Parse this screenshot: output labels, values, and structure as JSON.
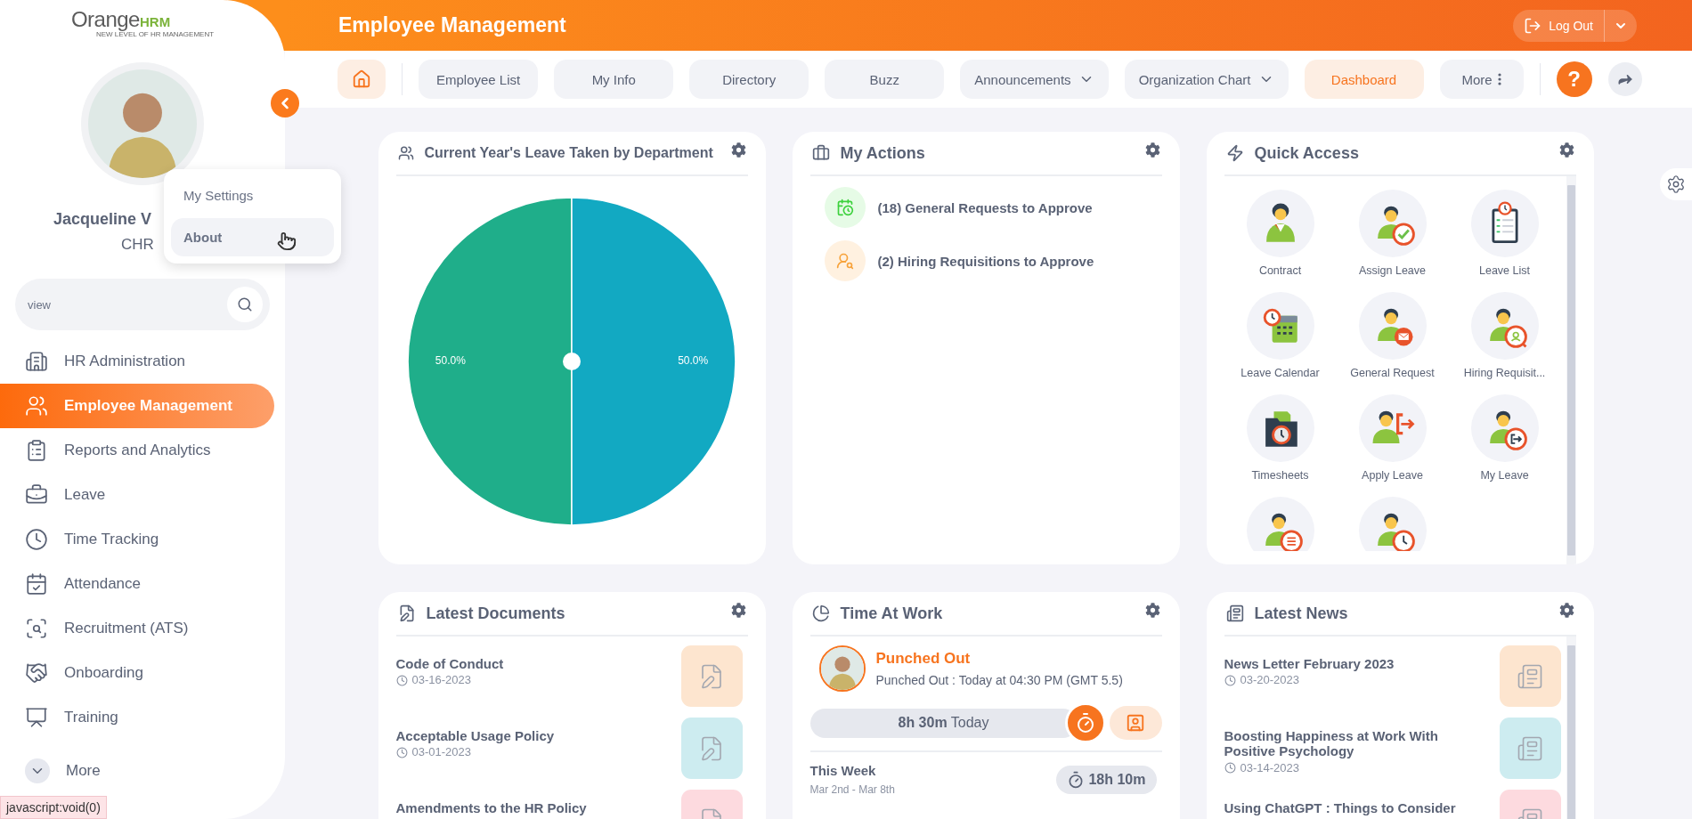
{
  "sidebar": {
    "logo": {
      "word": "Orange",
      "suffix": "HRM",
      "tagline": "NEW LEVEL OF HR MANAGEMENT"
    },
    "profile": {
      "name": "Jacqueline V",
      "role": "CHR"
    },
    "profile_menu": [
      {
        "label": "My Settings",
        "selected": false
      },
      {
        "label": "About",
        "selected": true
      }
    ],
    "search": {
      "placeholder": "view"
    },
    "items": [
      {
        "label": "HR Administration",
        "kind": "building",
        "selected": false
      },
      {
        "label": "Employee Management",
        "kind": "people",
        "selected": true
      },
      {
        "label": "Reports and Analytics",
        "kind": "report",
        "selected": false
      },
      {
        "label": "Leave",
        "kind": "leave",
        "selected": false
      },
      {
        "label": "Time Tracking",
        "kind": "time",
        "selected": false
      },
      {
        "label": "Attendance",
        "kind": "attendance",
        "selected": false
      },
      {
        "label": "Recruitment (ATS)",
        "kind": "recruit",
        "selected": false
      },
      {
        "label": "Onboarding",
        "kind": "onboarding",
        "selected": false
      },
      {
        "label": "Training",
        "kind": "training",
        "selected": false
      },
      {
        "label": "More",
        "kind": "more",
        "selected": false
      }
    ]
  },
  "header": {
    "title": "Employee Management",
    "logout_label": "Log Out"
  },
  "tabs": [
    {
      "kind": "home",
      "selected": false
    },
    {
      "kind": "tab",
      "label": "Employee List",
      "selected": false
    },
    {
      "kind": "tab",
      "label": "My Info",
      "selected": false
    },
    {
      "kind": "tab",
      "label": "Directory",
      "selected": false
    },
    {
      "kind": "tab",
      "label": "Buzz",
      "selected": false
    },
    {
      "kind": "dropdown",
      "label": "Announcements",
      "selected": false
    },
    {
      "kind": "dropdown",
      "label": "Organization Chart",
      "selected": false
    },
    {
      "kind": "tab",
      "label": "Dashboard",
      "selected": true
    },
    {
      "kind": "more",
      "label": "More",
      "selected": false
    }
  ],
  "help_label": "?",
  "leave_card": {
    "title": "Current Year's Leave Taken by Department",
    "chart_data": {
      "type": "pie",
      "values": [
        50,
        50
      ],
      "value_labels": [
        "50.0%",
        "50.0%"
      ],
      "colors": [
        "#1fae8a",
        "#12a9c2"
      ]
    }
  },
  "actions_card": {
    "title": "My Actions",
    "items": [
      {
        "label": "(18) General Requests to Approve",
        "color": "#e6fbe6"
      },
      {
        "label": "(2) Hiring Requisitions to Approve",
        "color": "#fff1e0"
      }
    ]
  },
  "quick_access": {
    "title": "Quick Access",
    "items": [
      {
        "label": "Contract",
        "kind": "woman"
      },
      {
        "label": "Assign Leave",
        "kind": "check"
      },
      {
        "label": "Leave List",
        "kind": "clipboard"
      },
      {
        "label": "Leave Calendar",
        "kind": "calendar"
      },
      {
        "label": "General Request",
        "kind": "mail"
      },
      {
        "label": "Hiring Requisit...",
        "kind": "search"
      },
      {
        "label": "Timesheets",
        "kind": "folder"
      },
      {
        "label": "Apply Leave",
        "kind": "exit"
      },
      {
        "label": "My Leave",
        "kind": "exitbadge"
      },
      {
        "kind": "doc"
      },
      {
        "kind": "clock"
      }
    ]
  },
  "documents": {
    "title": "Latest Documents",
    "items": [
      {
        "title": "Code of Conduct",
        "date": "03-16-2023",
        "color": "#fde5cf"
      },
      {
        "title": "Acceptable Usage Policy",
        "date": "03-01-2023",
        "color": "#cdecf0"
      },
      {
        "title": "Amendments to the HR Policy",
        "color": "#fddadf"
      }
    ]
  },
  "time_at_work": {
    "title": "Time At Work",
    "status": "Punched Out",
    "detail": "Punched Out : Today at 04:30 PM (GMT 5.5)",
    "today": "**8h 30m** Today",
    "week_label": "This Week",
    "week_range": "Mar 2nd - Mar 8th",
    "week_total": "18h 10m"
  },
  "news": {
    "title": "Latest News",
    "items": [
      {
        "title": "News Letter February 2023",
        "date": "03-20-2023",
        "color": "#fde5cf"
      },
      {
        "title": "Boosting Happiness at Work With Positive Psychology",
        "date": "03-14-2023",
        "color": "#cdecf0"
      },
      {
        "title": "Using ChatGPT : Things to Consider",
        "color": "#fddadf"
      }
    ]
  },
  "status_bar": "javascript:void(0)"
}
